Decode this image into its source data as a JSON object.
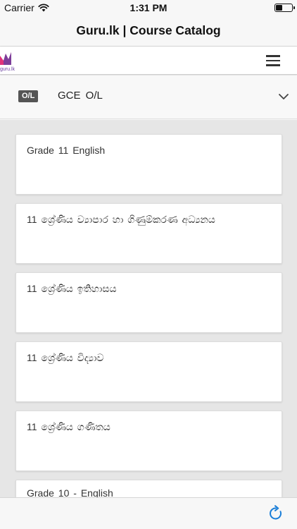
{
  "status_bar": {
    "carrier": "Carrier",
    "time": "1:31 PM",
    "battery_level": 0.45
  },
  "nav": {
    "title": "Guru.lk | Course Catalog"
  },
  "header": {
    "logo_text": "guru.lk",
    "menu_icon": "hamburger-icon"
  },
  "level_selector": {
    "badge": "O/L",
    "label": "GCE O/L",
    "chevron_icon": "chevron-down-icon"
  },
  "courses": [
    {
      "title": "Grade 11 English"
    },
    {
      "title": "11 ශ්‍රේණිය ව්‍යාපාර හා ගිණුම්කරණ අධ්‍යනය"
    },
    {
      "title": "11 ශ්‍රේණිය ඉතිහාසය"
    },
    {
      "title": "11 ශ්‍රේණිය විද්‍යාව"
    },
    {
      "title": "11 ශ්‍රේණිය ගණිතය"
    },
    {
      "title": "Grade 10 - English"
    }
  ],
  "toolbar": {
    "refresh_icon": "refresh-icon"
  },
  "colors": {
    "accent": "#1a7ed8",
    "logo_pink": "#e0337a",
    "logo_purple": "#6a3fa0",
    "list_background": "#e6e6e6"
  }
}
